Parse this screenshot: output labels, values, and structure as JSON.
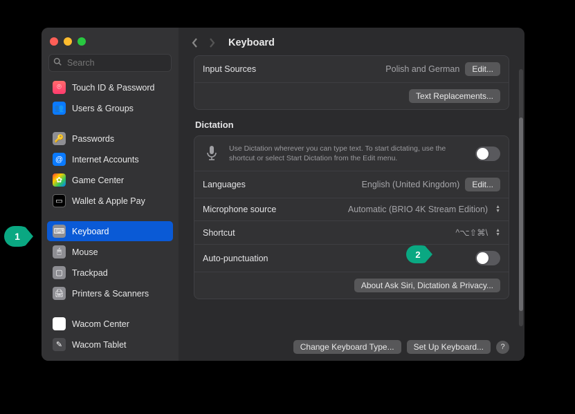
{
  "window": {
    "title": "Keyboard",
    "search_placeholder": "Search"
  },
  "sidebar": {
    "items": [
      {
        "label": "Touch ID & Password",
        "icon": "touchid",
        "iconGlyph": "⌾"
      },
      {
        "label": "Users & Groups",
        "icon": "users",
        "iconGlyph": "👥"
      },
      {
        "label": "Passwords",
        "icon": "passwords",
        "iconGlyph": "🔑"
      },
      {
        "label": "Internet Accounts",
        "icon": "internet",
        "iconGlyph": "@"
      },
      {
        "label": "Game Center",
        "icon": "gamecenter",
        "iconGlyph": "✿"
      },
      {
        "label": "Wallet & Apple Pay",
        "icon": "wallet",
        "iconGlyph": "▭"
      },
      {
        "label": "Keyboard",
        "icon": "keyboard",
        "iconGlyph": "⌨",
        "selected": true
      },
      {
        "label": "Mouse",
        "icon": "mouse",
        "iconGlyph": "🖱"
      },
      {
        "label": "Trackpad",
        "icon": "trackpad",
        "iconGlyph": "▢"
      },
      {
        "label": "Printers & Scanners",
        "icon": "printers",
        "iconGlyph": "🖨"
      },
      {
        "label": "Wacom Center",
        "icon": "wacomcenter",
        "iconGlyph": "w"
      },
      {
        "label": "Wacom Tablet",
        "icon": "wacomtablet",
        "iconGlyph": "✎"
      }
    ]
  },
  "main": {
    "inputSources": {
      "label": "Input Sources",
      "value": "Polish and German",
      "editLabel": "Edit..."
    },
    "textReplacements": "Text Replacements...",
    "dictation": {
      "title": "Dictation",
      "intro": "Use Dictation wherever you can type text. To start dictating, use the shortcut or select Start Dictation from the Edit menu.",
      "toggle": false,
      "languages": {
        "label": "Languages",
        "value": "English (United Kingdom)",
        "editLabel": "Edit..."
      },
      "mic": {
        "label": "Microphone source",
        "value": "Automatic (BRIO 4K Stream Edition)"
      },
      "shortcut": {
        "label": "Shortcut",
        "value": "^⌥⇧⌘\\"
      },
      "autoPunct": {
        "label": "Auto-punctuation",
        "on": false
      },
      "aboutBtn": "About Ask Siri, Dictation & Privacy..."
    },
    "footer": {
      "changeType": "Change Keyboard Type...",
      "setup": "Set Up Keyboard...",
      "help": "?"
    }
  },
  "annotations": {
    "a1": "1",
    "a2": "2"
  }
}
